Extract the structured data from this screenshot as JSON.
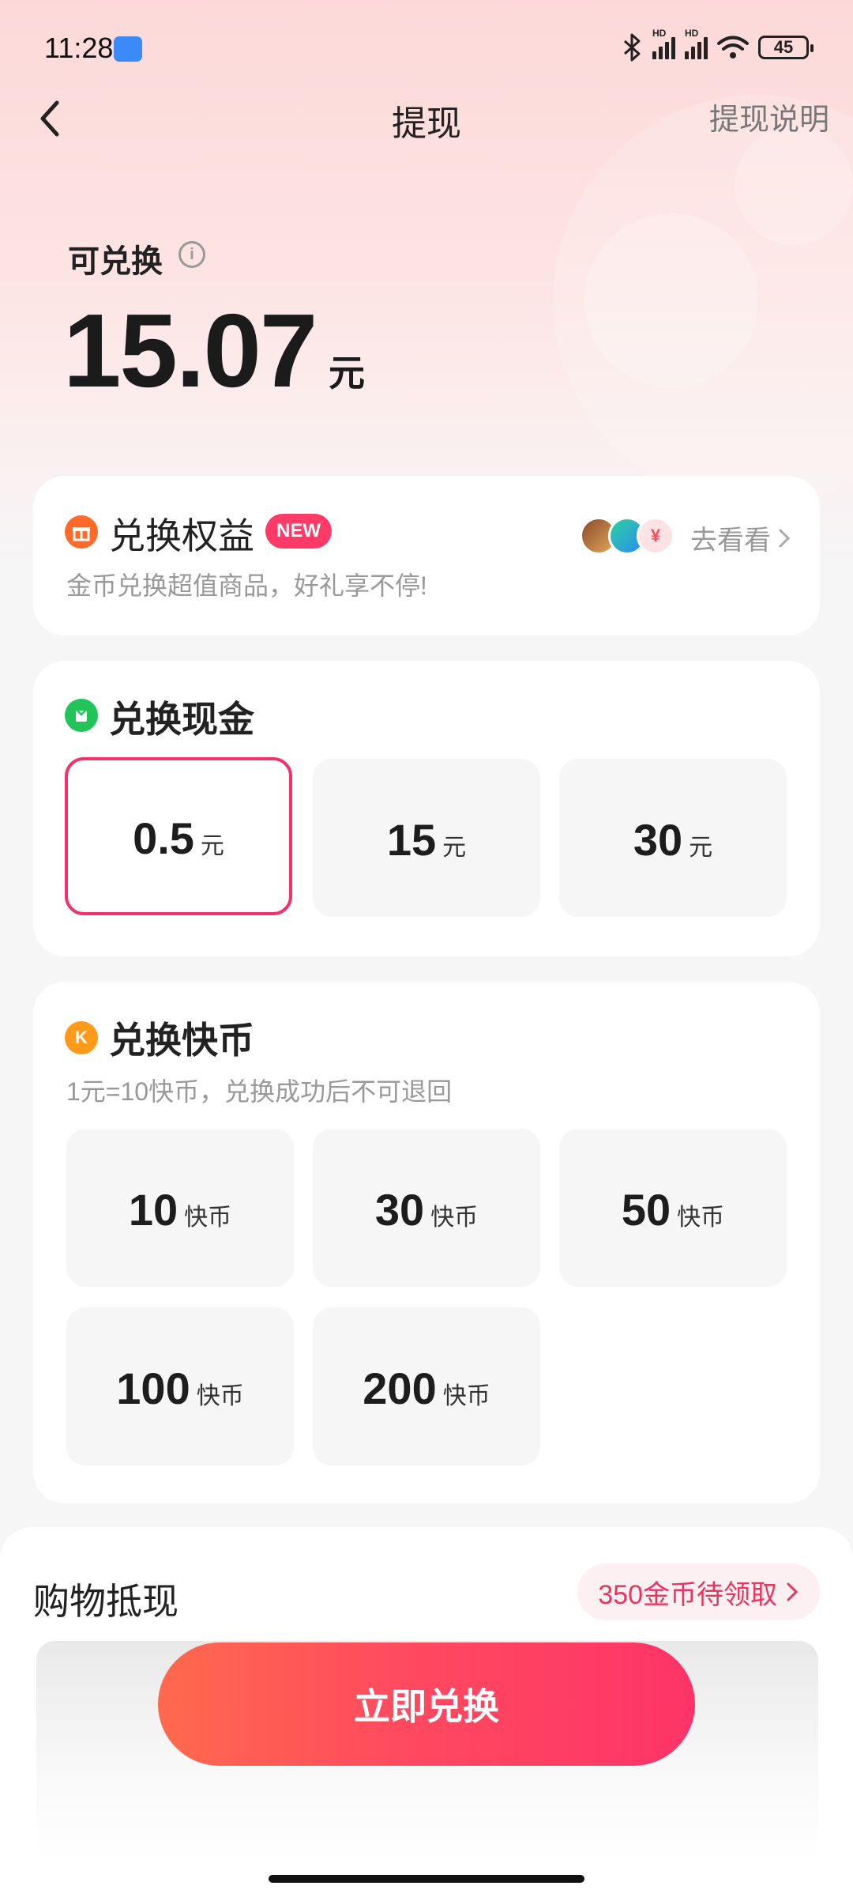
{
  "status_bar": {
    "time": "11:28",
    "battery": "45",
    "hd1": "HD",
    "hd2": "HD"
  },
  "header": {
    "title": "提现",
    "help_link": "提现说明"
  },
  "balance": {
    "label": "可兑换",
    "value": "15.07",
    "unit": "元"
  },
  "benefits": {
    "title": "兑换权益",
    "badge": "NEW",
    "subtitle": "金币兑换超值商品，好礼享不停!",
    "link": "去看看",
    "coin_symbol": "¥"
  },
  "cash": {
    "title": "兑换现金",
    "options": [
      {
        "amount": "0.5",
        "unit": "元",
        "selected": true
      },
      {
        "amount": "15",
        "unit": "元",
        "selected": false
      },
      {
        "amount": "30",
        "unit": "元",
        "selected": false
      }
    ]
  },
  "kcoin": {
    "title": "兑换快币",
    "icon_letter": "K",
    "subtitle": "1元=10快币，兑换成功后不可退回",
    "options": [
      {
        "amount": "10",
        "unit": "快币"
      },
      {
        "amount": "30",
        "unit": "快币"
      },
      {
        "amount": "50",
        "unit": "快币"
      },
      {
        "amount": "100",
        "unit": "快币"
      },
      {
        "amount": "200",
        "unit": "快币"
      }
    ]
  },
  "shopping": {
    "title": "购物抵现",
    "coins_pending": "350金币待领取"
  },
  "primary_action": {
    "label": "立即兑换"
  },
  "colors": {
    "accent": "#fe3468",
    "selected_border": "#f2336a",
    "cash_icon": "#22c45a",
    "gift_icon": "#ff6a2b",
    "kcoin_icon": "#ff9a1a"
  }
}
